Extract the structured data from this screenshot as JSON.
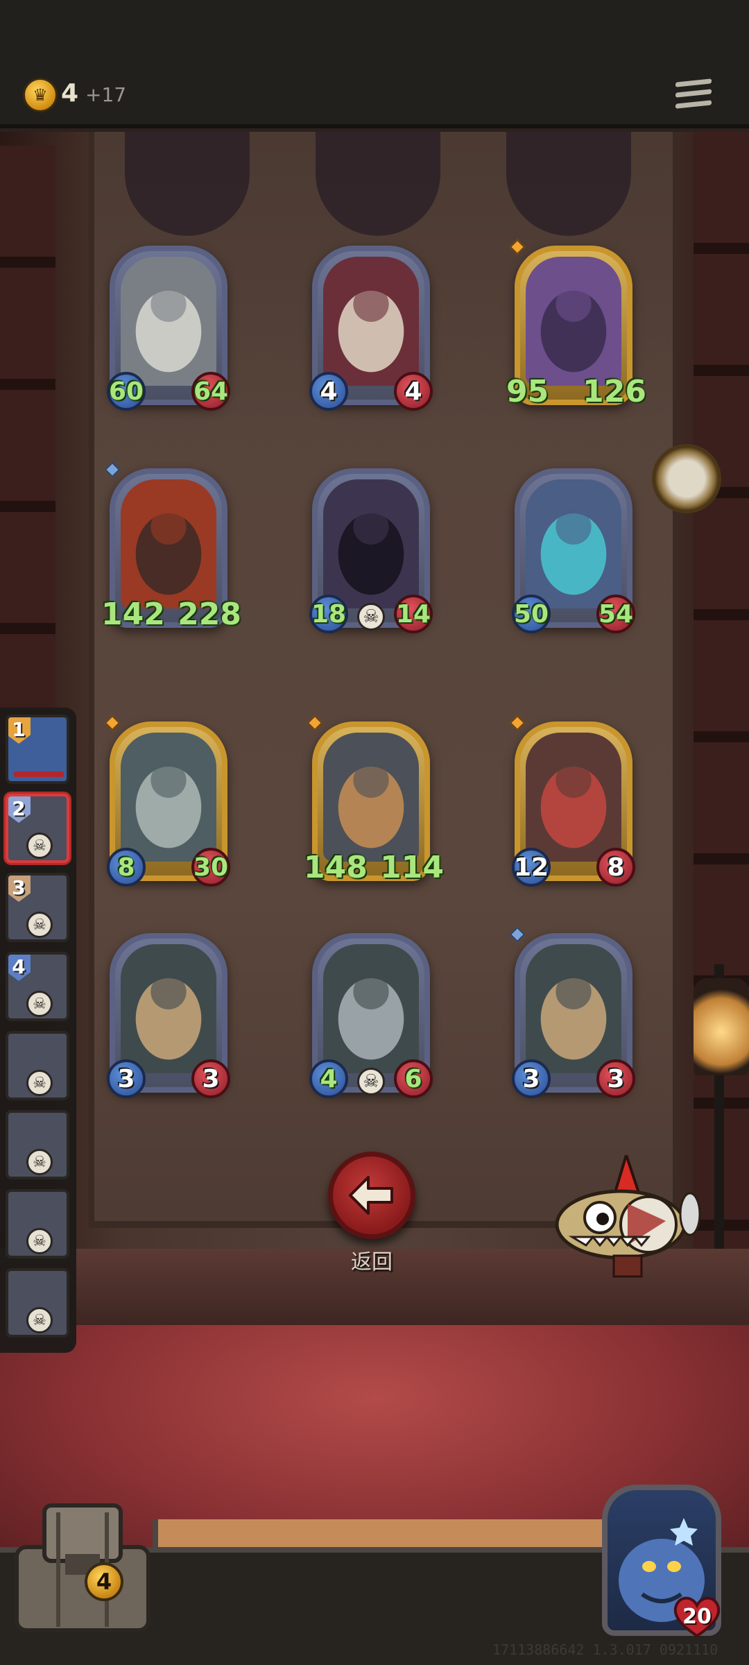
{
  "top_bar": {
    "gold_amount": "4",
    "gold_income": "+17",
    "gold_icon": "crown-coin-icon",
    "menu_icon": "hamburger-menu-icon"
  },
  "board": {
    "rows": [
      [
        {
          "name": "cannon",
          "attack": "60",
          "health": "64",
          "frame": "silver",
          "attack_buffed": true,
          "health_buffed": true
        },
        {
          "name": "clown",
          "attack": "4",
          "health": "4",
          "frame": "silver",
          "attack_buffed": false,
          "health_buffed": false
        },
        {
          "name": "octopus-pirate",
          "attack": "95",
          "health": "126",
          "frame": "gold",
          "attack_buffed": true,
          "health_buffed": true
        }
      ],
      [
        {
          "name": "hooded-assassin",
          "attack": "142",
          "health": "228",
          "frame": "silver",
          "attack_buffed": true,
          "health_buffed": true
        },
        {
          "name": "dark-monk",
          "attack": "18",
          "health": "14",
          "frame": "silver",
          "attack_buffed": true,
          "health_buffed": true
        },
        {
          "name": "sea-sorceress",
          "attack": "50",
          "health": "54",
          "frame": "silver",
          "attack_buffed": true,
          "health_buffed": true
        }
      ],
      [
        {
          "name": "shark-brute",
          "attack": "8",
          "health": "30",
          "frame": "gold",
          "attack_buffed": true,
          "health_buffed": true
        },
        {
          "name": "spear-boy",
          "attack": "148",
          "health": "114",
          "frame": "gold",
          "attack_buffed": true,
          "health_buffed": true
        },
        {
          "name": "red-mech",
          "attack": "12",
          "health": "8",
          "frame": "gold",
          "attack_buffed": false,
          "health_buffed": false
        }
      ],
      [
        {
          "name": "missile-rig",
          "attack": "3",
          "health": "3",
          "frame": "silver",
          "attack_buffed": false,
          "health_buffed": false
        },
        {
          "name": "robot-bell",
          "attack": "4",
          "health": "6",
          "frame": "silver",
          "attack_buffed": true,
          "health_buffed": true
        },
        {
          "name": "missile-rig",
          "attack": "3",
          "health": "3",
          "frame": "silver",
          "attack_buffed": false,
          "health_buffed": false
        }
      ]
    ]
  },
  "return_button": {
    "label": "返回",
    "icon": "arrow-left-icon"
  },
  "lineup": [
    {
      "number": "1",
      "status": "alive"
    },
    {
      "number": "2",
      "status": "dead"
    },
    {
      "number": "3",
      "status": "dead"
    },
    {
      "number": "4",
      "status": "dead"
    },
    {
      "number": "",
      "status": "dead"
    },
    {
      "number": "",
      "status": "dead"
    },
    {
      "number": "",
      "status": "dead"
    },
    {
      "number": "",
      "status": "dead"
    }
  ],
  "bottom": {
    "chest_count": "4",
    "hero_health": "20"
  },
  "build_info": "17113886642 1.3.017 0921110",
  "colors": {
    "attack_badge": "#2c4f96",
    "health_badge": "#8e1e2a",
    "buffed_stat": "#a9e77e",
    "return_button": "#a72727"
  }
}
